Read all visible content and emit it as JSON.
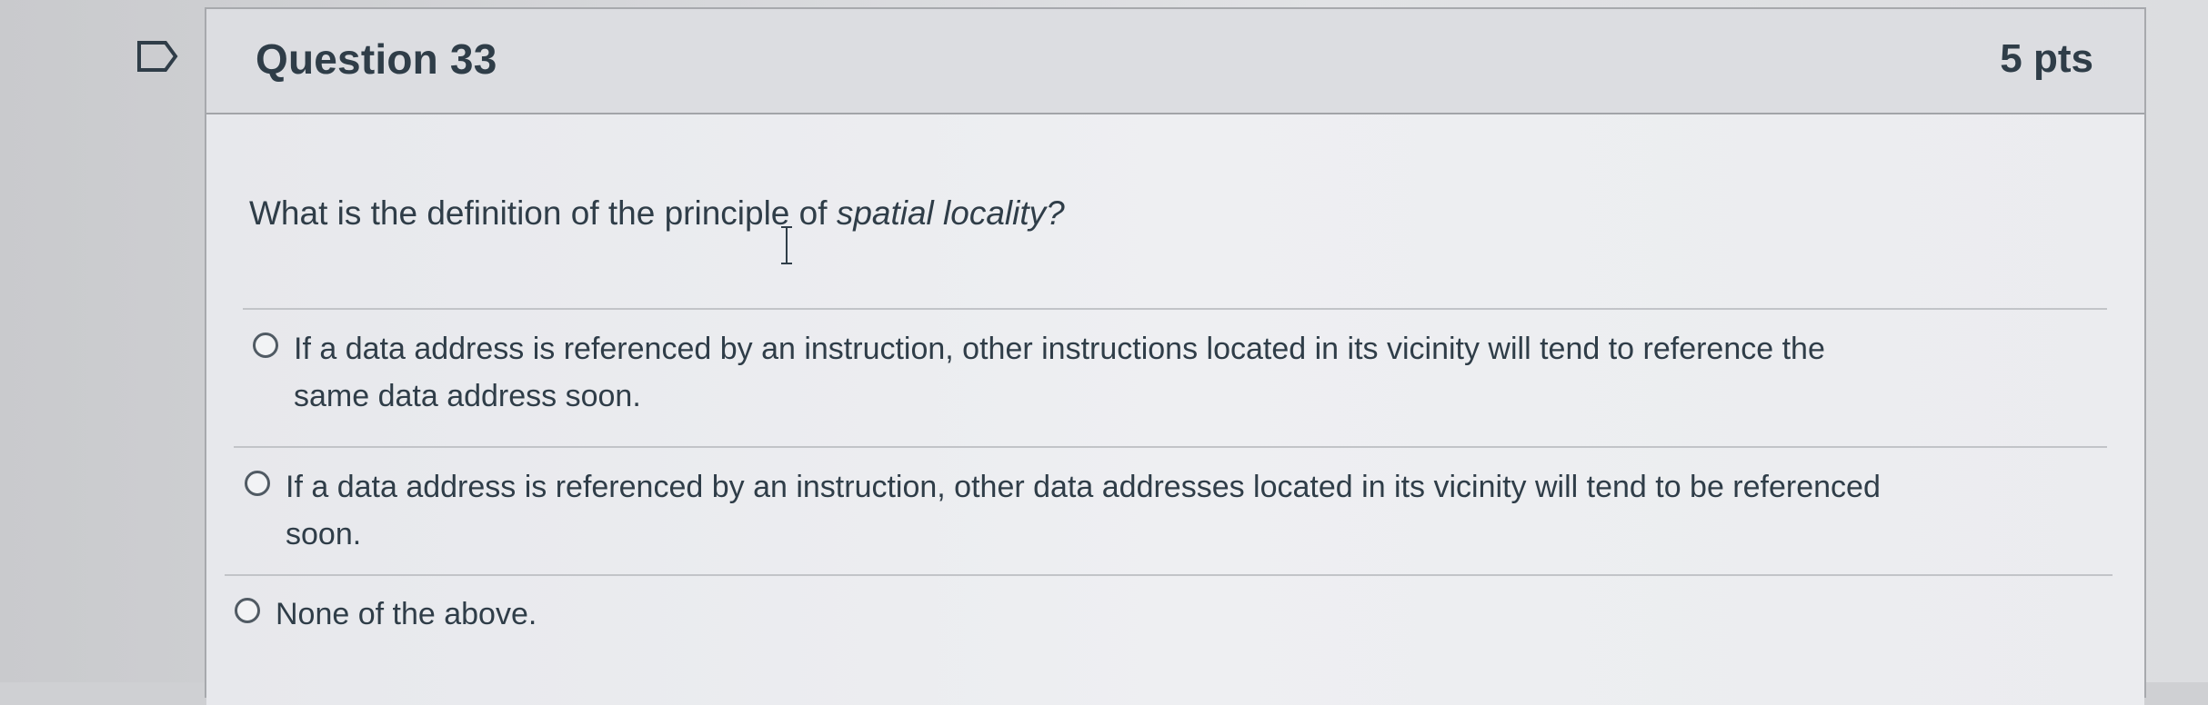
{
  "question": {
    "title": "Question 33",
    "points": "5 pts",
    "text_before": "What is the definition of the principle of ",
    "text_emphasis": "spatial locality?",
    "flag_icon": "flag-bookmark-icon"
  },
  "answers": [
    {
      "label_line1": "If a data address is referenced by an instruction, other instructions located in its vicinity will tend to reference the",
      "label_line2": "same data address soon.",
      "selected": false
    },
    {
      "label_line1": "If a data address is referenced by an instruction, other data addresses located in its vicinity will tend to be referenced",
      "label_line2": "soon.",
      "selected": false
    },
    {
      "label_line1": "None of the above.",
      "label_line2": "",
      "selected": false
    }
  ]
}
